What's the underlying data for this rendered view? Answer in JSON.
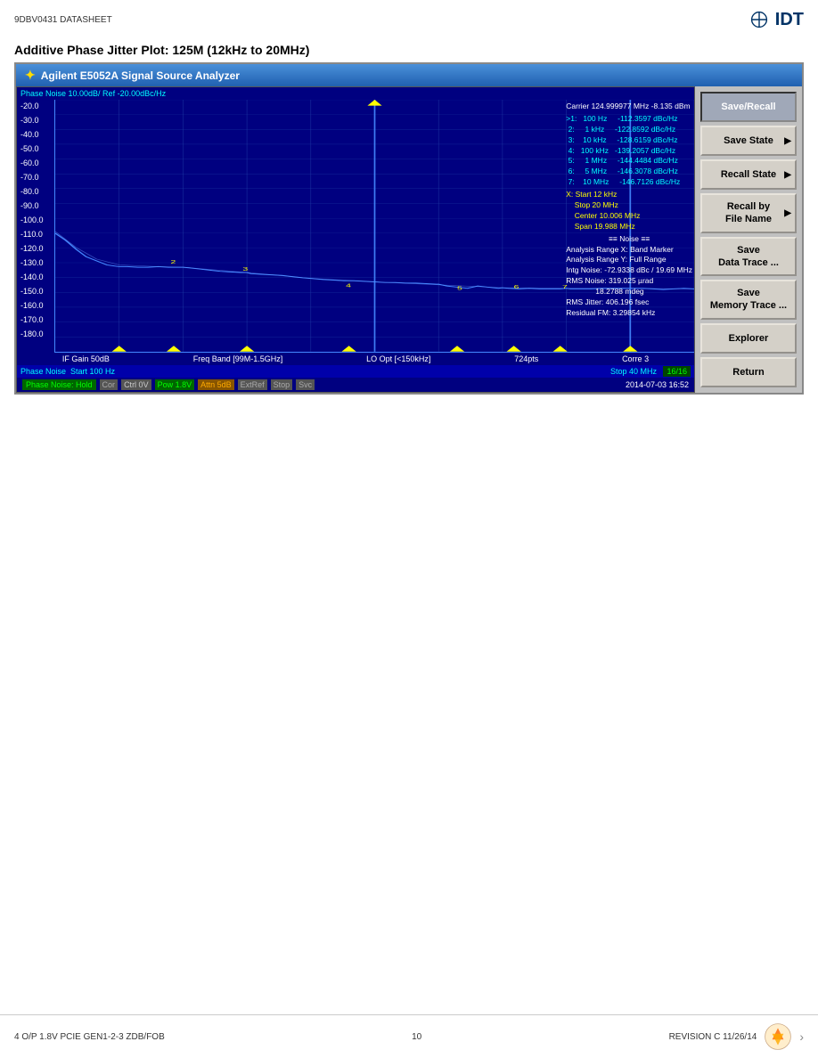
{
  "header": {
    "doc_id": "9DBV0431  DATASHEET",
    "logo_text": "IDT"
  },
  "chart_title": "Additive Phase Jitter Plot: 125M (12kHz to 20MHz)",
  "instrument": {
    "title": "Agilent E5052A Signal Source Analyzer",
    "phase_noise_label": "Phase Noise 10.00dB/ Ref -20.00dBc/Hz",
    "carrier_line": "Carrier 124.999977 MHz    -8.135 dBm",
    "markers": [
      {
        "id": ">1:",
        "freq": "100 Hz",
        "value": "-112.3597 dBc/Hz"
      },
      {
        "id": "2:",
        "freq": "1 kHz",
        "value": "-122.8592 dBc/Hz"
      },
      {
        "id": "3:",
        "freq": "10 kHz",
        "value": "-128.6159 dBc/Hz"
      },
      {
        "id": "4:",
        "freq": "100 kHz",
        "value": "-139.2057 dBc/Hz"
      },
      {
        "id": "5:",
        "freq": "1 MHz",
        "value": "-144.4484 dBc/Hz"
      },
      {
        "id": "6:",
        "freq": "5 MHz",
        "value": "-146.3078 dBc/Hz"
      },
      {
        "id": "7:",
        "freq": "10 MHz",
        "value": "-146.7126 dBc/Hz"
      }
    ],
    "x_info": {
      "start": "Start 12 kHz",
      "stop": "Stop 20 MHz",
      "center": "Center 10.006 MHz",
      "span": "Span 19.988 MHz"
    },
    "noise_info": {
      "header": "=== Noise ===",
      "analysis_x": "Analysis Range X: Band Marker",
      "analysis_y": "Analysis Range Y: Full Range",
      "intg_noise": "Intg Noise: -72.9338 dBc / 19.69  MHz",
      "rms_noise1": "RMS Noise: 319.025 µrad",
      "rms_noise2": "18.2788 mdeg",
      "rms_jitter": "RMS Jitter: 406.196 fsec",
      "residual_fm": "Residual FM: 3.29854 kHz"
    },
    "y_axis_labels": [
      "-20.0",
      "-30.0",
      "-40.0",
      "-50.0",
      "-60.0",
      "-70.0",
      "-80.0",
      "-90.0",
      "-100.0",
      "-110.0",
      "-120.0",
      "-130.0",
      "-140.0",
      "-150.0",
      "-160.0",
      "-170.0",
      "-180.0"
    ],
    "status_bar": {
      "items": [
        {
          "label": "IF Gain 50dB",
          "type": "normal"
        },
        {
          "label": "Freq Band [99M-1.5GHz]",
          "type": "normal"
        },
        {
          "label": "LO Opt [<150kHz]",
          "type": "normal"
        },
        {
          "label": "724pts",
          "type": "normal"
        },
        {
          "label": "Corre 3",
          "type": "normal"
        }
      ]
    },
    "bottom_bar": {
      "left": "Phase Noise  Start 100 Hz",
      "right": "Stop 40 MHz  16/16"
    },
    "status_strip": {
      "items": [
        {
          "label": "Phase Noise: Hold",
          "type": "highlight"
        },
        {
          "label": "Cor",
          "type": "gray"
        },
        {
          "label": "Ctrl  0V",
          "type": "gray"
        },
        {
          "label": "Pow  1.8V",
          "type": "highlight"
        },
        {
          "label": "Attn 5dB",
          "type": "yellow"
        },
        {
          "label": "ExtRef",
          "type": "gray"
        },
        {
          "label": "Stop",
          "type": "gray"
        },
        {
          "label": "Svc",
          "type": "gray"
        },
        {
          "label": "2014-07-03 16:52",
          "type": "normal"
        }
      ]
    }
  },
  "sidebar": {
    "buttons": [
      {
        "label": "Save/Recall",
        "active": true,
        "has_arrow": false
      },
      {
        "label": "Save State",
        "active": false,
        "has_arrow": true
      },
      {
        "label": "Recall State",
        "active": false,
        "has_arrow": true
      },
      {
        "label": "Recall by\nFile Name",
        "active": false,
        "has_arrow": true
      },
      {
        "label": "Save\nData Trace ...",
        "active": false,
        "has_arrow": false
      },
      {
        "label": "Save\nMemory Trace ...",
        "active": false,
        "has_arrow": false
      },
      {
        "label": "Explorer",
        "active": false,
        "has_arrow": false
      },
      {
        "label": "Return",
        "active": false,
        "has_arrow": false
      }
    ]
  },
  "footer": {
    "left": "4 O/P 1.8V PCIE GEN1-2-3 ZDB/FOB",
    "center": "10",
    "right": "REVISION C  11/26/14"
  }
}
